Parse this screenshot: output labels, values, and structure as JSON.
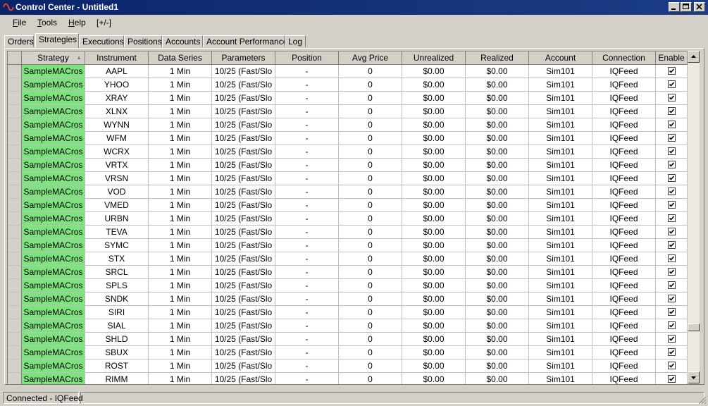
{
  "window": {
    "title": "Control Center - Untitled1"
  },
  "menu": [
    {
      "pre": "",
      "key": "F",
      "post": "ile"
    },
    {
      "pre": "",
      "key": "T",
      "post": "ools"
    },
    {
      "pre": "",
      "key": "H",
      "post": "elp"
    },
    {
      "pre": "[+/-]",
      "key": "",
      "post": ""
    }
  ],
  "tabs": [
    "Orders",
    "Strategies",
    "Executions",
    "Positions",
    "Accounts",
    "Account Performance",
    "Log"
  ],
  "active_tab": "Strategies",
  "grid": {
    "columns": [
      "Strategy",
      "Instrument",
      "Data Series",
      "Parameters",
      "Position",
      "Avg Price",
      "Unrealized",
      "Realized",
      "Account",
      "Connection",
      "Enable"
    ],
    "sort_column": "Strategy",
    "strategy_color": "#7ee27e",
    "rows": [
      [
        "SampleMACros",
        "AAPL",
        "1 Min",
        "10/25 (Fast/Slo",
        "-",
        "0",
        "$0.00",
        "$0.00",
        "Sim101",
        "IQFeed",
        true
      ],
      [
        "SampleMACros",
        "YHOO",
        "1 Min",
        "10/25 (Fast/Slo",
        "-",
        "0",
        "$0.00",
        "$0.00",
        "Sim101",
        "IQFeed",
        true
      ],
      [
        "SampleMACros",
        "XRAY",
        "1 Min",
        "10/25 (Fast/Slo",
        "-",
        "0",
        "$0.00",
        "$0.00",
        "Sim101",
        "IQFeed",
        true
      ],
      [
        "SampleMACros",
        "XLNX",
        "1 Min",
        "10/25 (Fast/Slo",
        "-",
        "0",
        "$0.00",
        "$0.00",
        "Sim101",
        "IQFeed",
        true
      ],
      [
        "SampleMACros",
        "WYNN",
        "1 Min",
        "10/25 (Fast/Slo",
        "-",
        "0",
        "$0.00",
        "$0.00",
        "Sim101",
        "IQFeed",
        true
      ],
      [
        "SampleMACros",
        "WFM",
        "1 Min",
        "10/25 (Fast/Slo",
        "-",
        "0",
        "$0.00",
        "$0.00",
        "Sim101",
        "IQFeed",
        true
      ],
      [
        "SampleMACros",
        "WCRX",
        "1 Min",
        "10/25 (Fast/Slo",
        "-",
        "0",
        "$0.00",
        "$0.00",
        "Sim101",
        "IQFeed",
        true
      ],
      [
        "SampleMACros",
        "VRTX",
        "1 Min",
        "10/25 (Fast/Slo",
        "-",
        "0",
        "$0.00",
        "$0.00",
        "Sim101",
        "IQFeed",
        true
      ],
      [
        "SampleMACros",
        "VRSN",
        "1 Min",
        "10/25 (Fast/Slo",
        "-",
        "0",
        "$0.00",
        "$0.00",
        "Sim101",
        "IQFeed",
        true
      ],
      [
        "SampleMACros",
        "VOD",
        "1 Min",
        "10/25 (Fast/Slo",
        "-",
        "0",
        "$0.00",
        "$0.00",
        "Sim101",
        "IQFeed",
        true
      ],
      [
        "SampleMACros",
        "VMED",
        "1 Min",
        "10/25 (Fast/Slo",
        "-",
        "0",
        "$0.00",
        "$0.00",
        "Sim101",
        "IQFeed",
        true
      ],
      [
        "SampleMACros",
        "URBN",
        "1 Min",
        "10/25 (Fast/Slo",
        "-",
        "0",
        "$0.00",
        "$0.00",
        "Sim101",
        "IQFeed",
        true
      ],
      [
        "SampleMACros",
        "TEVA",
        "1 Min",
        "10/25 (Fast/Slo",
        "-",
        "0",
        "$0.00",
        "$0.00",
        "Sim101",
        "IQFeed",
        true
      ],
      [
        "SampleMACros",
        "SYMC",
        "1 Min",
        "10/25 (Fast/Slo",
        "-",
        "0",
        "$0.00",
        "$0.00",
        "Sim101",
        "IQFeed",
        true
      ],
      [
        "SampleMACros",
        "STX",
        "1 Min",
        "10/25 (Fast/Slo",
        "-",
        "0",
        "$0.00",
        "$0.00",
        "Sim101",
        "IQFeed",
        true
      ],
      [
        "SampleMACros",
        "SRCL",
        "1 Min",
        "10/25 (Fast/Slo",
        "-",
        "0",
        "$0.00",
        "$0.00",
        "Sim101",
        "IQFeed",
        true
      ],
      [
        "SampleMACros",
        "SPLS",
        "1 Min",
        "10/25 (Fast/Slo",
        "-",
        "0",
        "$0.00",
        "$0.00",
        "Sim101",
        "IQFeed",
        true
      ],
      [
        "SampleMACros",
        "SNDK",
        "1 Min",
        "10/25 (Fast/Slo",
        "-",
        "0",
        "$0.00",
        "$0.00",
        "Sim101",
        "IQFeed",
        true
      ],
      [
        "SampleMACros",
        "SIRI",
        "1 Min",
        "10/25 (Fast/Slo",
        "-",
        "0",
        "$0.00",
        "$0.00",
        "Sim101",
        "IQFeed",
        true
      ],
      [
        "SampleMACros",
        "SIAL",
        "1 Min",
        "10/25 (Fast/Slo",
        "-",
        "0",
        "$0.00",
        "$0.00",
        "Sim101",
        "IQFeed",
        true
      ],
      [
        "SampleMACros",
        "SHLD",
        "1 Min",
        "10/25 (Fast/Slo",
        "-",
        "0",
        "$0.00",
        "$0.00",
        "Sim101",
        "IQFeed",
        true
      ],
      [
        "SampleMACros",
        "SBUX",
        "1 Min",
        "10/25 (Fast/Slo",
        "-",
        "0",
        "$0.00",
        "$0.00",
        "Sim101",
        "IQFeed",
        true
      ],
      [
        "SampleMACros",
        "ROST",
        "1 Min",
        "10/25 (Fast/Slo",
        "-",
        "0",
        "$0.00",
        "$0.00",
        "Sim101",
        "IQFeed",
        true
      ],
      [
        "SampleMACros",
        "RIMM",
        "1 Min",
        "10/25 (Fast/Slo",
        "-",
        "0",
        "$0.00",
        "$0.00",
        "Sim101",
        "IQFeed",
        true
      ]
    ]
  },
  "status": {
    "connection": "Connected - IQFeed"
  }
}
